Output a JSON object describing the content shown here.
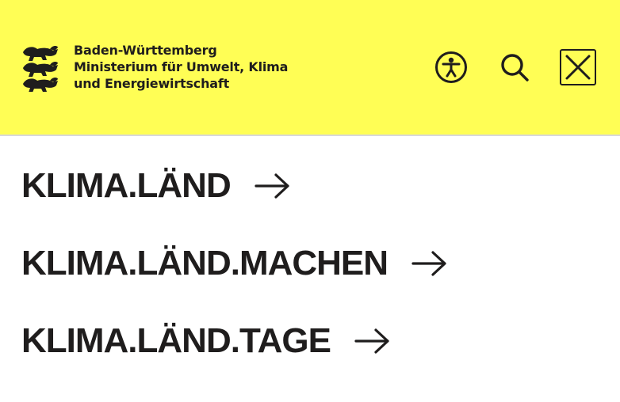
{
  "header": {
    "org_lines": [
      "Baden-Württemberg",
      "Ministerium für Umwelt, Klima",
      "und Energiewirtschaft"
    ],
    "background": "#fffe55",
    "icons": [
      "coat-of-arms-icon",
      "accessibility-icon",
      "search-icon",
      "close-icon"
    ]
  },
  "menu": {
    "items": [
      {
        "label": "KLIMA.LÄND"
      },
      {
        "label": "KLIMA.LÄND.MACHEN"
      },
      {
        "label": "KLIMA.LÄND.TAGE"
      }
    ],
    "arrow_icon": "arrow-right-icon"
  },
  "colors": {
    "text": "#1f1d1d",
    "divider": "#d8d8d8"
  }
}
